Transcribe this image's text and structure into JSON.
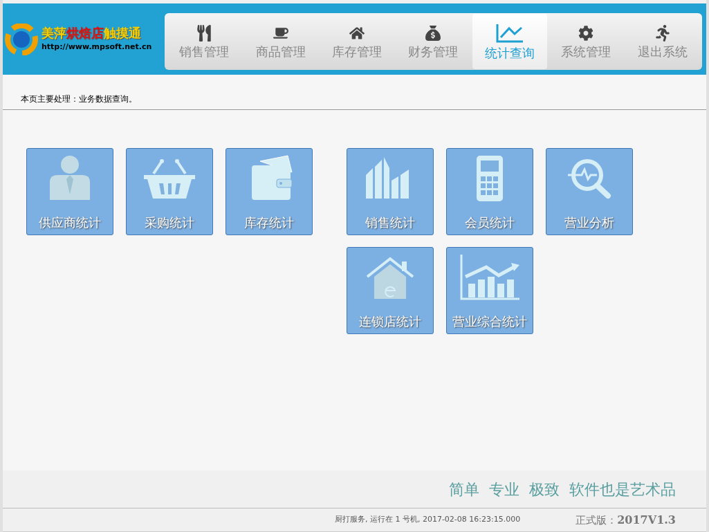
{
  "header": {
    "logo_title": [
      {
        "text": "美萍",
        "color": "#f5d000"
      },
      {
        "text": "烘焙店",
        "color": "#e01010"
      },
      {
        "text": "触摸通",
        "color": "#f5d000"
      }
    ],
    "logo_url": "http://www.mpsoft.net.cn",
    "nav": [
      {
        "kind": "utensils",
        "label": "销售管理",
        "selected": false
      },
      {
        "kind": "coffee",
        "label": "商品管理",
        "selected": false
      },
      {
        "kind": "house",
        "label": "库存管理",
        "selected": false
      },
      {
        "kind": "moneybag",
        "label": "财务管理",
        "selected": false
      },
      {
        "kind": "chart",
        "label": "统计查询",
        "selected": true
      },
      {
        "kind": "gear",
        "label": "系统管理",
        "selected": false
      },
      {
        "kind": "runner",
        "label": "退出系统",
        "selected": false
      }
    ]
  },
  "page_note": "本页主要处理：业务数据查询。",
  "tile_groups": [
    [
      {
        "kind": "person",
        "label": "供应商统计"
      },
      {
        "kind": "basket",
        "label": "采购统计"
      },
      {
        "kind": "wallet",
        "label": "库存统计"
      }
    ],
    [
      {
        "kind": "bars",
        "label": "销售统计"
      },
      {
        "kind": "calculator",
        "label": "会员统计"
      },
      {
        "kind": "magnifier",
        "label": "营业分析"
      },
      {
        "kind": "house",
        "label": "连锁店统计"
      },
      {
        "kind": "trend",
        "label": "营业综合统计"
      }
    ]
  ],
  "footer": {
    "slogan": "简单  专业  极致  软件也是艺术品",
    "status": "厨打服务, 运行在 1 号机, 2017-02-08 16:23:15.000",
    "version_label": "正式版：",
    "version": "2017V1.3"
  }
}
